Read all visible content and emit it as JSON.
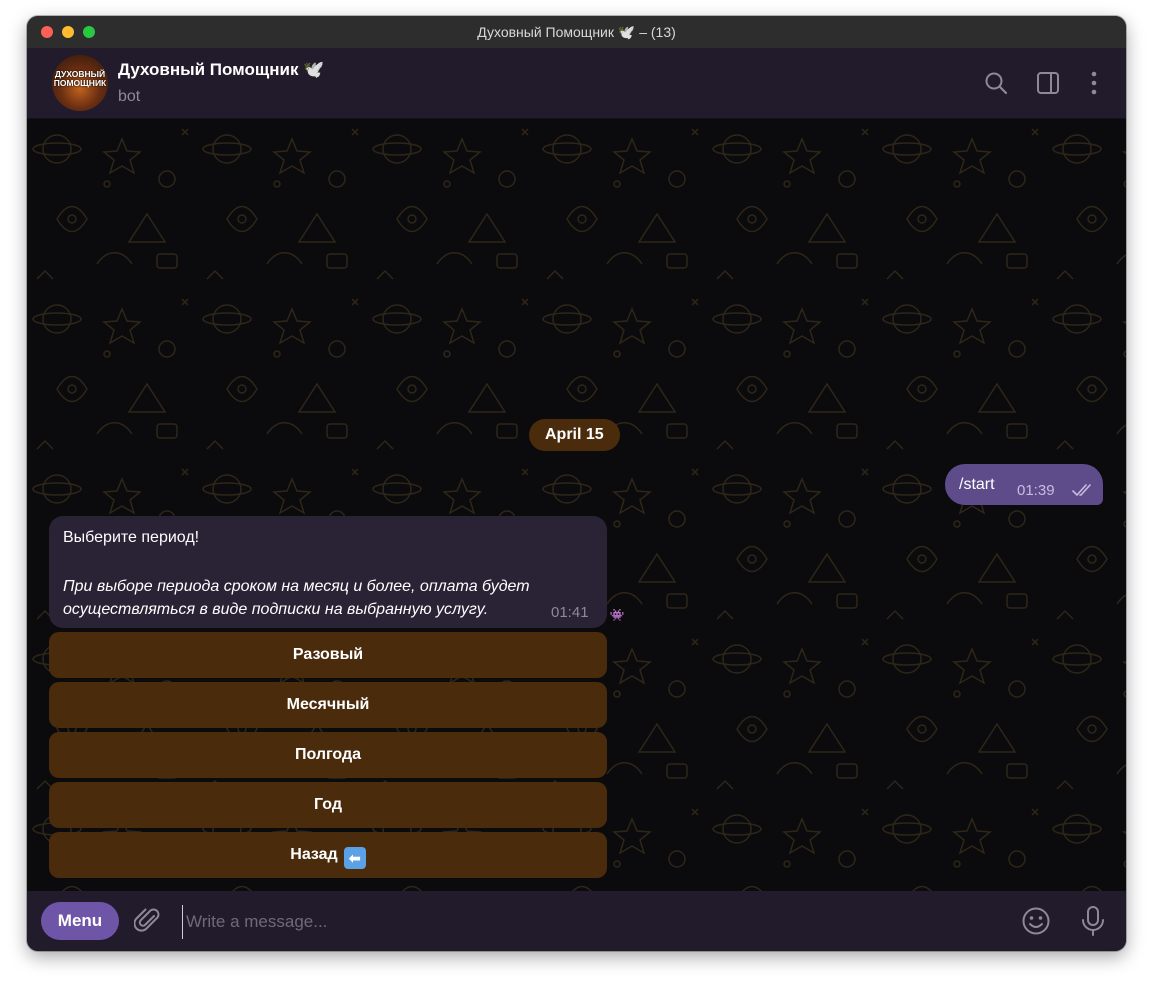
{
  "window": {
    "title": "Духовный Помощник 🕊️ – (13)"
  },
  "header": {
    "avatar_text": "ДУХОВНЫЙ ПОМОЩНИК",
    "chat_name": "Духовный Помощник 🕊️",
    "status": "bot",
    "icons": [
      "search-icon",
      "sidebar-toggle-icon",
      "more-vertical-icon"
    ]
  },
  "chat": {
    "date_label": "April 15",
    "outgoing": {
      "text": "/start",
      "time": "01:39",
      "status_icon": "double-check-icon"
    },
    "incoming": {
      "line1": "Выберите период!",
      "line2": "При выборе периода сроком на месяц и более, оплата будет осуществляться в виде подписки на выбранную услугу.",
      "time": "01:41",
      "reaction": "👾"
    },
    "keyboard": [
      {
        "label": "Разовый"
      },
      {
        "label": "Месячный"
      },
      {
        "label": "Полгода"
      },
      {
        "label": "Год"
      },
      {
        "label": "Назад",
        "emoji": "⬅"
      }
    ]
  },
  "composer": {
    "menu_label": "Menu",
    "placeholder": "Write a message...",
    "icons": [
      "paperclip-icon",
      "emoji-icon",
      "microphone-icon"
    ]
  },
  "colors": {
    "accent": "#6e55a8",
    "keyboard_button": "#4a2c0c",
    "outgoing_bubble": "#5e4b8a",
    "incoming_bubble": "#2a2235",
    "header_bg": "#221b2c",
    "chat_bg": "#0b0a0c"
  }
}
